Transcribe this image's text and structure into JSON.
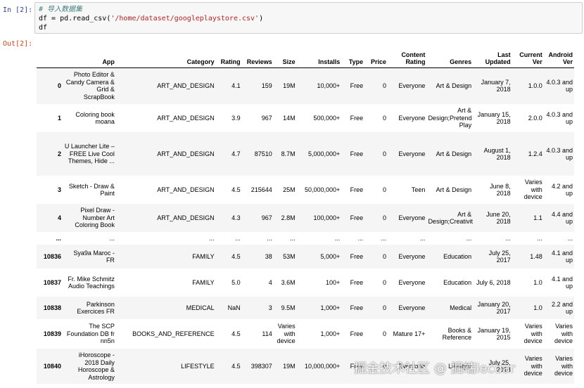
{
  "input_prompt": "In  [2]:",
  "output_prompt": "Out[2]:",
  "code": {
    "comment": "# 导入数据集",
    "line2_pre": "df = pd.read_csv(",
    "line2_str": "'/home/dataset/googleplaystore.csv'",
    "line2_post": ")",
    "line3": "df"
  },
  "table": {
    "columns": [
      "App",
      "Category",
      "Rating",
      "Reviews",
      "Size",
      "Installs",
      "Type",
      "Price",
      "Content Rating",
      "Genres",
      "Last Updated",
      "Current Ver",
      "Android Ver"
    ],
    "rows": [
      {
        "index": "0",
        "cells": [
          "Photo Editor & Candy Camera & Grid & ScrapBook",
          "ART_AND_DESIGN",
          "4.1",
          "159",
          "19M",
          "10,000+",
          "Free",
          "0",
          "Everyone",
          "Art & Design",
          "January 7, 2018",
          "1.0.0",
          "4.0.3 and up"
        ]
      },
      {
        "index": "1",
        "cells": [
          "Coloring book moana",
          "ART_AND_DESIGN",
          "3.9",
          "967",
          "14M",
          "500,000+",
          "Free",
          "0",
          "Everyone",
          "Art & Design;Pretend Play",
          "January 15, 2018",
          "2.0.0",
          "4.0.3 and up"
        ]
      },
      {
        "index": "2",
        "cells": [
          "U Launcher Lite – FREE Live Cool Themes, Hide ...",
          "ART_AND_DESIGN",
          "4.7",
          "87510",
          "8.7M",
          "5,000,000+",
          "Free",
          "0",
          "Everyone",
          "Art & Design",
          "August 1, 2018",
          "1.2.4",
          "4.0.3 and up"
        ]
      },
      {
        "index": "3",
        "cells": [
          "Sketch - Draw & Paint",
          "ART_AND_DESIGN",
          "4.5",
          "215644",
          "25M",
          "50,000,000+",
          "Free",
          "0",
          "Teen",
          "Art & Design",
          "June 8, 2018",
          "Varies with device",
          "4.2 and up"
        ]
      },
      {
        "index": "4",
        "cells": [
          "Pixel Draw - Number Art Coloring Book",
          "ART_AND_DESIGN",
          "4.3",
          "967",
          "2.8M",
          "100,000+",
          "Free",
          "0",
          "Everyone",
          "Art & Design;Creativity",
          "June 20, 2018",
          "1.1",
          "4.4 and up"
        ]
      },
      {
        "index": "...",
        "cells": [
          "...",
          "...",
          "...",
          "...",
          "...",
          "...",
          "...",
          "...",
          "...",
          "...",
          "...",
          "...",
          "..."
        ]
      },
      {
        "index": "10836",
        "cells": [
          "Sya9a Maroc - FR",
          "FAMILY",
          "4.5",
          "38",
          "53M",
          "5,000+",
          "Free",
          "0",
          "Everyone",
          "Education",
          "July 25, 2017",
          "1.48",
          "4.1 and up"
        ]
      },
      {
        "index": "10837",
        "cells": [
          "Fr. Mike Schmitz Audio Teachings",
          "FAMILY",
          "5.0",
          "4",
          "3.6M",
          "100+",
          "Free",
          "0",
          "Everyone",
          "Education",
          "July 6, 2018",
          "1.0",
          "4.1 and up"
        ]
      },
      {
        "index": "10838",
        "cells": [
          "Parkinson Exercices FR",
          "MEDICAL",
          "NaN",
          "3",
          "9.5M",
          "1,000+",
          "Free",
          "0",
          "Everyone",
          "Medical",
          "January 20, 2017",
          "1.0",
          "2.2 and up"
        ]
      },
      {
        "index": "10839",
        "cells": [
          "The SCP Foundation DB fr nn5n",
          "BOOKS_AND_REFERENCE",
          "4.5",
          "114",
          "Varies with device",
          "1,000+",
          "Free",
          "0",
          "Mature 17+",
          "Books & Reference",
          "January 19, 2015",
          "Varies with device",
          "Varies with device"
        ]
      },
      {
        "index": "10840",
        "cells": [
          "iHoroscope - 2018 Daily Horoscope & Astrology",
          "LIFESTYLE",
          "4.5",
          "398307",
          "19M",
          "10,000,000+",
          "Free",
          "0",
          "Everyone",
          "Lifestyle",
          "July 25, 2018",
          "Varies with device",
          "Varies with device"
        ]
      }
    ]
  },
  "watermark": "掘金技术社区 @ 掘端lecdar"
}
